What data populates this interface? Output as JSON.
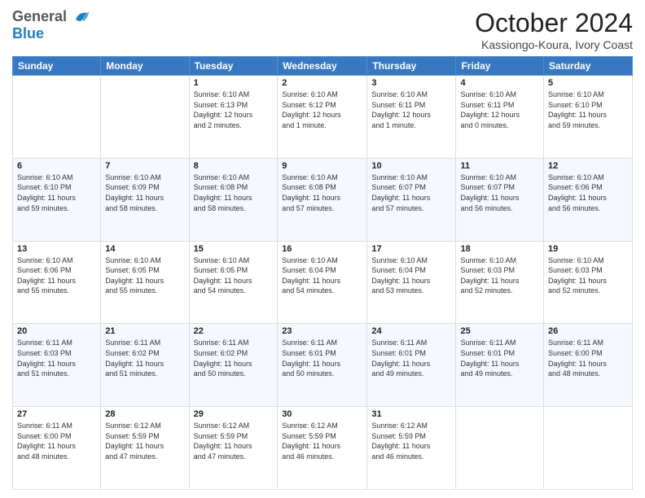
{
  "logo": {
    "general": "General",
    "blue": "Blue"
  },
  "header": {
    "month": "October 2024",
    "location": "Kassiongo-Koura, Ivory Coast"
  },
  "days_of_week": [
    "Sunday",
    "Monday",
    "Tuesday",
    "Wednesday",
    "Thursday",
    "Friday",
    "Saturday"
  ],
  "weeks": [
    [
      {
        "day": "",
        "info": ""
      },
      {
        "day": "",
        "info": ""
      },
      {
        "day": "1",
        "info": "Sunrise: 6:10 AM\nSunset: 6:13 PM\nDaylight: 12 hours\nand 2 minutes."
      },
      {
        "day": "2",
        "info": "Sunrise: 6:10 AM\nSunset: 6:12 PM\nDaylight: 12 hours\nand 1 minute."
      },
      {
        "day": "3",
        "info": "Sunrise: 6:10 AM\nSunset: 6:11 PM\nDaylight: 12 hours\nand 1 minute."
      },
      {
        "day": "4",
        "info": "Sunrise: 6:10 AM\nSunset: 6:11 PM\nDaylight: 12 hours\nand 0 minutes."
      },
      {
        "day": "5",
        "info": "Sunrise: 6:10 AM\nSunset: 6:10 PM\nDaylight: 11 hours\nand 59 minutes."
      }
    ],
    [
      {
        "day": "6",
        "info": "Sunrise: 6:10 AM\nSunset: 6:10 PM\nDaylight: 11 hours\nand 59 minutes."
      },
      {
        "day": "7",
        "info": "Sunrise: 6:10 AM\nSunset: 6:09 PM\nDaylight: 11 hours\nand 58 minutes."
      },
      {
        "day": "8",
        "info": "Sunrise: 6:10 AM\nSunset: 6:08 PM\nDaylight: 11 hours\nand 58 minutes."
      },
      {
        "day": "9",
        "info": "Sunrise: 6:10 AM\nSunset: 6:08 PM\nDaylight: 11 hours\nand 57 minutes."
      },
      {
        "day": "10",
        "info": "Sunrise: 6:10 AM\nSunset: 6:07 PM\nDaylight: 11 hours\nand 57 minutes."
      },
      {
        "day": "11",
        "info": "Sunrise: 6:10 AM\nSunset: 6:07 PM\nDaylight: 11 hours\nand 56 minutes."
      },
      {
        "day": "12",
        "info": "Sunrise: 6:10 AM\nSunset: 6:06 PM\nDaylight: 11 hours\nand 56 minutes."
      }
    ],
    [
      {
        "day": "13",
        "info": "Sunrise: 6:10 AM\nSunset: 6:06 PM\nDaylight: 11 hours\nand 55 minutes."
      },
      {
        "day": "14",
        "info": "Sunrise: 6:10 AM\nSunset: 6:05 PM\nDaylight: 11 hours\nand 55 minutes."
      },
      {
        "day": "15",
        "info": "Sunrise: 6:10 AM\nSunset: 6:05 PM\nDaylight: 11 hours\nand 54 minutes."
      },
      {
        "day": "16",
        "info": "Sunrise: 6:10 AM\nSunset: 6:04 PM\nDaylight: 11 hours\nand 54 minutes."
      },
      {
        "day": "17",
        "info": "Sunrise: 6:10 AM\nSunset: 6:04 PM\nDaylight: 11 hours\nand 53 minutes."
      },
      {
        "day": "18",
        "info": "Sunrise: 6:10 AM\nSunset: 6:03 PM\nDaylight: 11 hours\nand 52 minutes."
      },
      {
        "day": "19",
        "info": "Sunrise: 6:10 AM\nSunset: 6:03 PM\nDaylight: 11 hours\nand 52 minutes."
      }
    ],
    [
      {
        "day": "20",
        "info": "Sunrise: 6:11 AM\nSunset: 6:03 PM\nDaylight: 11 hours\nand 51 minutes."
      },
      {
        "day": "21",
        "info": "Sunrise: 6:11 AM\nSunset: 6:02 PM\nDaylight: 11 hours\nand 51 minutes."
      },
      {
        "day": "22",
        "info": "Sunrise: 6:11 AM\nSunset: 6:02 PM\nDaylight: 11 hours\nand 50 minutes."
      },
      {
        "day": "23",
        "info": "Sunrise: 6:11 AM\nSunset: 6:01 PM\nDaylight: 11 hours\nand 50 minutes."
      },
      {
        "day": "24",
        "info": "Sunrise: 6:11 AM\nSunset: 6:01 PM\nDaylight: 11 hours\nand 49 minutes."
      },
      {
        "day": "25",
        "info": "Sunrise: 6:11 AM\nSunset: 6:01 PM\nDaylight: 11 hours\nand 49 minutes."
      },
      {
        "day": "26",
        "info": "Sunrise: 6:11 AM\nSunset: 6:00 PM\nDaylight: 11 hours\nand 48 minutes."
      }
    ],
    [
      {
        "day": "27",
        "info": "Sunrise: 6:11 AM\nSunset: 6:00 PM\nDaylight: 11 hours\nand 48 minutes."
      },
      {
        "day": "28",
        "info": "Sunrise: 6:12 AM\nSunset: 5:59 PM\nDaylight: 11 hours\nand 47 minutes."
      },
      {
        "day": "29",
        "info": "Sunrise: 6:12 AM\nSunset: 5:59 PM\nDaylight: 11 hours\nand 47 minutes."
      },
      {
        "day": "30",
        "info": "Sunrise: 6:12 AM\nSunset: 5:59 PM\nDaylight: 11 hours\nand 46 minutes."
      },
      {
        "day": "31",
        "info": "Sunrise: 6:12 AM\nSunset: 5:59 PM\nDaylight: 11 hours\nand 46 minutes."
      },
      {
        "day": "",
        "info": ""
      },
      {
        "day": "",
        "info": ""
      }
    ]
  ]
}
